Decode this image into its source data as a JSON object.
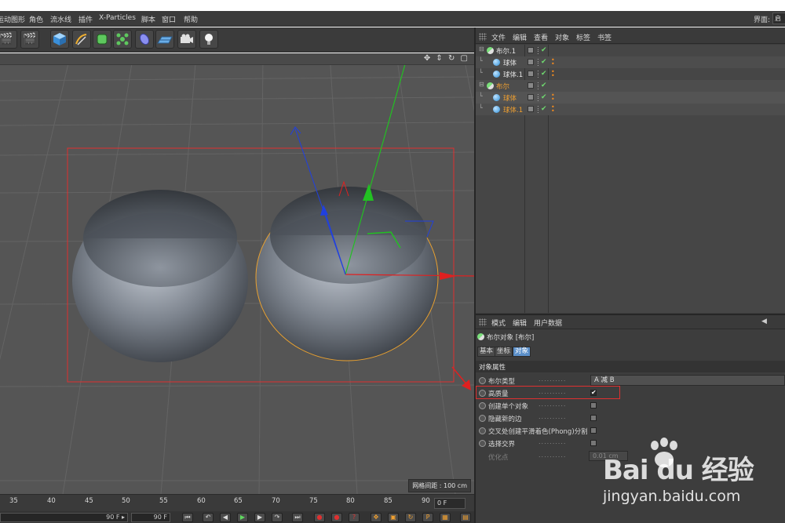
{
  "menubar": {
    "items": [
      "运动图形",
      "角色",
      "流水线",
      "插件",
      "X-Particles",
      "脚本",
      "窗口",
      "帮助"
    ],
    "interface_label": "界面:",
    "interface_value": "启"
  },
  "toolbar": {
    "icons": [
      "render-active-view-icon",
      "render-settings-icon",
      "cube-icon",
      "pen-spline-icon",
      "subdivision-icon",
      "array-cloner-icon",
      "deformer-icon",
      "floor-plane-icon",
      "camera-icon",
      "light-bulb-icon"
    ]
  },
  "viewport": {
    "nav_icons": "✥ ⇕ ↻ ▢",
    "grid_label": "网格间距 : 100 cm"
  },
  "timeline": {
    "ticks": [
      "35",
      "40",
      "45",
      "50",
      "55",
      "60",
      "65",
      "70",
      "75",
      "80",
      "85",
      "90"
    ],
    "frame_value": "0 F",
    "end_field_1": "90 F ▸",
    "end_field_2": "90 F"
  },
  "object_manager": {
    "menu": [
      "文件",
      "编辑",
      "查看",
      "对象",
      "标签",
      "书签"
    ],
    "rows": [
      {
        "name": "布尔.1",
        "type": "bool",
        "indent": 0,
        "selected": false
      },
      {
        "name": "球体",
        "type": "sphere",
        "indent": 1,
        "selected": false
      },
      {
        "name": "球体.1",
        "type": "sphere",
        "indent": 1,
        "selected": false
      },
      {
        "name": "布尔",
        "type": "bool",
        "indent": 0,
        "selected": true
      },
      {
        "name": "球体",
        "type": "sphere",
        "indent": 1,
        "selected": true
      },
      {
        "name": "球体.1",
        "type": "sphere",
        "indent": 1,
        "selected": true
      }
    ]
  },
  "attribute_manager": {
    "menu": [
      "模式",
      "编辑",
      "用户数据"
    ],
    "title": "布尔对象 [布尔]",
    "tabs": [
      "基本",
      "坐标",
      "对象"
    ],
    "active_tab": "对象",
    "section": "对象属性",
    "props": [
      {
        "label": "布尔类型",
        "value": "A 减 B",
        "kind": "dropdown"
      },
      {
        "label": "高质量",
        "value": "✔",
        "kind": "checkbox-on"
      },
      {
        "label": "创建单个对象",
        "kind": "checkbox"
      },
      {
        "label": "隐藏新的边",
        "kind": "checkbox"
      },
      {
        "label": "交叉处创建平滑着色(Phong)分割",
        "kind": "checkbox"
      },
      {
        "label": "选择交界",
        "kind": "checkbox"
      },
      {
        "label": "优化点",
        "value": "0.01 cm",
        "kind": "number-disabled"
      }
    ]
  },
  "watermark": {
    "logo_text": "Bai du 经验",
    "url": "jingyan.baidu.com"
  },
  "colors": {
    "selection_orange": "#f0a030",
    "active_tab_blue": "#5b8fc9",
    "highlight_red": "#e03030",
    "axis_x": "#e02020",
    "axis_y": "#22c022",
    "axis_z": "#2040e0"
  }
}
